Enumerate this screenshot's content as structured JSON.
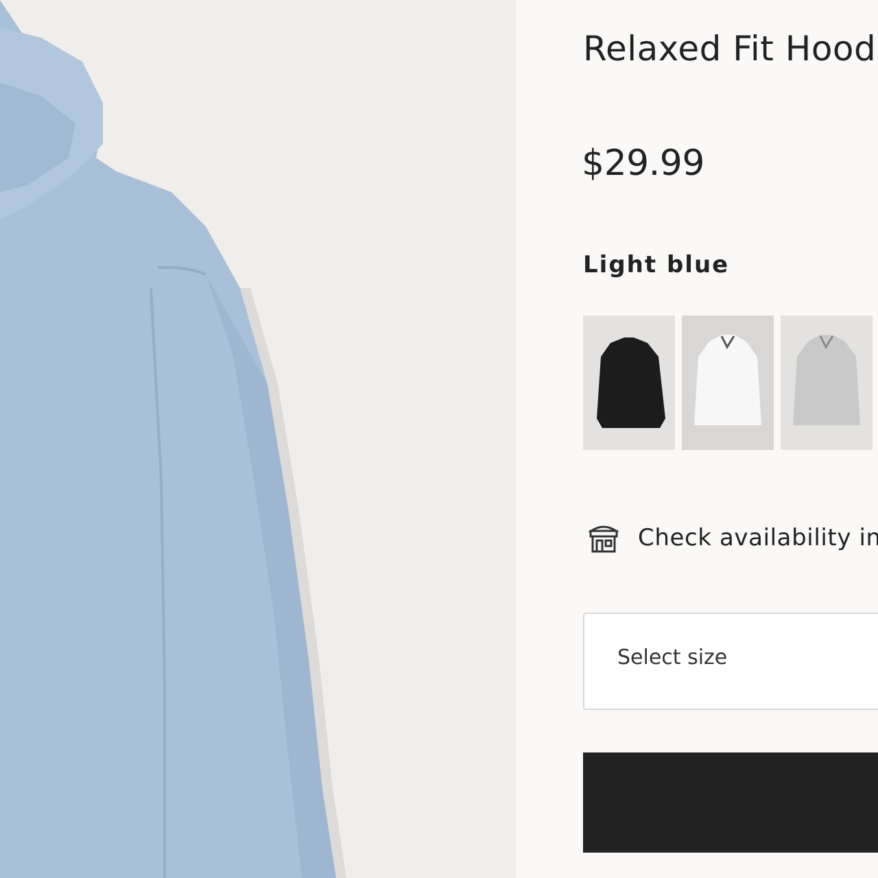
{
  "product": {
    "title": "Relaxed Fit Hoodie",
    "price": "$29.99",
    "selected_color": "Light blue",
    "main_image_color": "#a9c0d9",
    "swatches": [
      {
        "name": "Black",
        "color": "#1c1c1c"
      },
      {
        "name": "White",
        "color": "#f7f7f7"
      },
      {
        "name": "Light gray",
        "color": "#c9c9c9"
      }
    ]
  },
  "store": {
    "icon": "store-icon",
    "label": "Check availability in store"
  },
  "size_selector": {
    "value": "Select size"
  },
  "cart": {
    "button_color": "#222222"
  }
}
